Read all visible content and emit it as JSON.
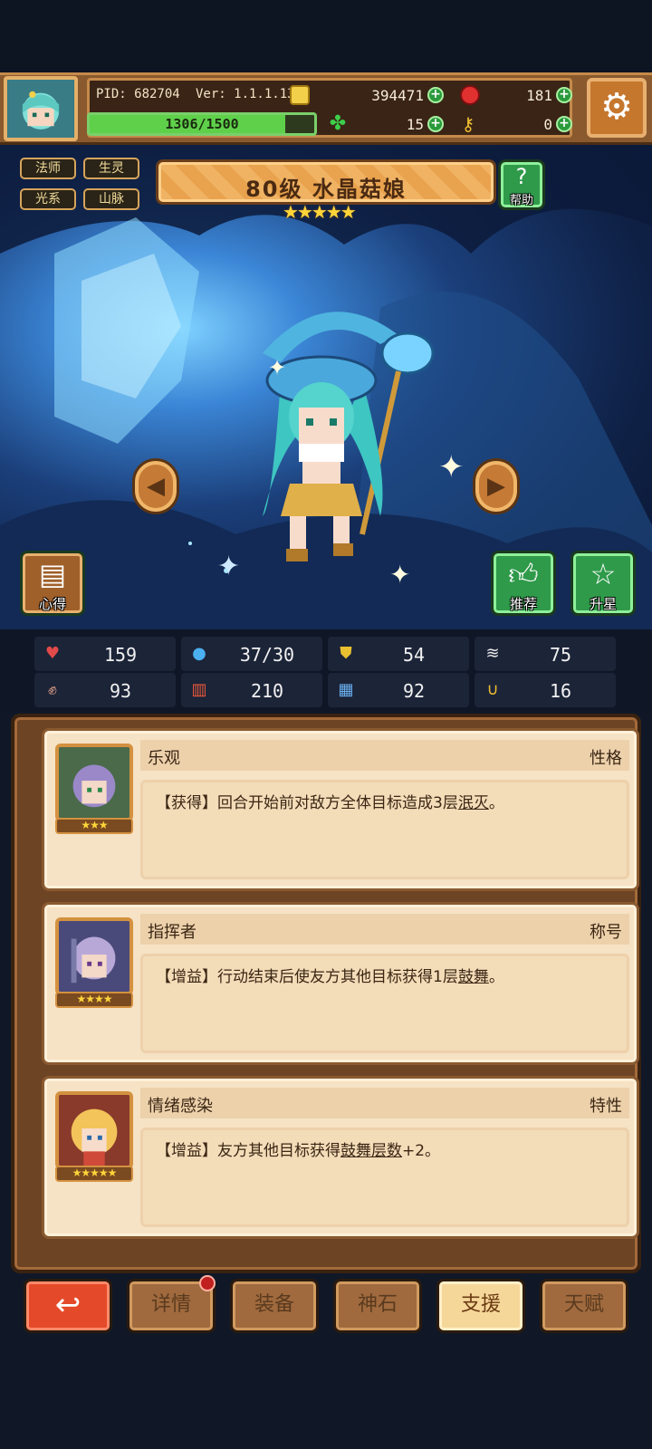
{
  "header": {
    "pid": "PID: 682704",
    "version": "Ver: 1.1.1.13",
    "gold": "394471",
    "red_gems": "181",
    "energy": "1306/1500",
    "energy_fraction": 0.871,
    "clovers": "15",
    "keys": "0"
  },
  "character": {
    "tags": [
      "法师",
      "生灵",
      "光系",
      "山脉"
    ],
    "title": "80级 水晶菇娘",
    "star_count": 5,
    "stars": "★★★★★",
    "help_label": "帮助",
    "insight_label": "心得",
    "recommend_label": "推荐",
    "upgrade_star_label": "升星"
  },
  "stats": {
    "hp": "159",
    "mana": "37/30",
    "defense": "54",
    "speed": "75",
    "attack": "93",
    "magic": "210",
    "resist": "92",
    "crit": "16"
  },
  "support": [
    {
      "name": "乐观",
      "type": "性格",
      "stars": "★★★",
      "desc_prefix": "【获得】回合开始前对敌方全体目标造成3层",
      "desc_keyword": "泯灭",
      "desc_suffix": "。"
    },
    {
      "name": "指挥者",
      "type": "称号",
      "stars": "★★★★",
      "desc_prefix": "【增益】行动结束后使友方其他目标获得1层",
      "desc_keyword": "鼓舞",
      "desc_suffix": "。"
    },
    {
      "name": "情绪感染",
      "type": "特性",
      "stars": "★★★★★",
      "desc_prefix": "【增益】友方其他目标获得",
      "desc_keyword": "鼓舞层数",
      "desc_suffix": "+2。"
    }
  ],
  "nav": {
    "back_icon": "↩",
    "items": [
      "详情",
      "装备",
      "神石",
      "支援",
      "天赋"
    ],
    "active": "支援"
  },
  "colors": {
    "accent": "#e9a34e",
    "panel": "#6d4424",
    "card": "#f6e2c4",
    "back_button": "#e44a2a"
  }
}
